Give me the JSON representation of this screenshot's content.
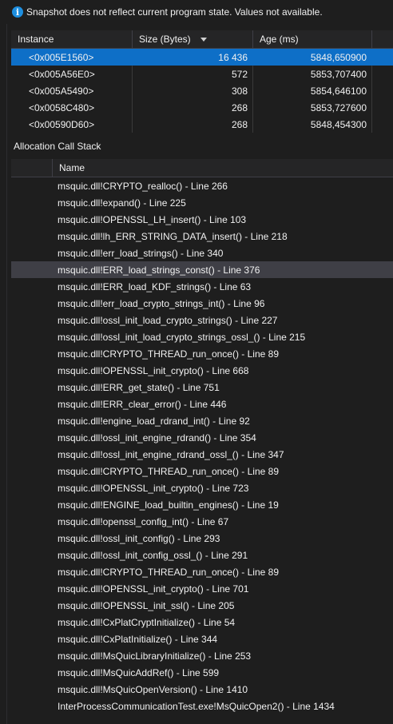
{
  "info_bar": {
    "icon": "info-icon",
    "message": "Snapshot does not reflect current program state. Values not available."
  },
  "instances": {
    "columns": [
      "Instance",
      "Size (Bytes)",
      "Age (ms)"
    ],
    "sort_column": "Size (Bytes)",
    "sort_direction": "descending",
    "rows": [
      {
        "instance": "<0x005E1560>",
        "size": "16 436",
        "age": "5848,650900",
        "selected": true
      },
      {
        "instance": "<0x005A56E0>",
        "size": "572",
        "age": "5853,707400",
        "selected": false
      },
      {
        "instance": "<0x005A5490>",
        "size": "308",
        "age": "5854,646100",
        "selected": false
      },
      {
        "instance": "<0x0058C480>",
        "size": "268",
        "age": "5853,727600",
        "selected": false
      },
      {
        "instance": "<0x00590D60>",
        "size": "268",
        "age": "5848,454300",
        "selected": false
      }
    ]
  },
  "call_stack": {
    "title": "Allocation Call Stack",
    "column": "Name",
    "highlighted_index": 5,
    "frames": [
      "msquic.dll!CRYPTO_realloc() - Line 266",
      "msquic.dll!expand() - Line 225",
      "msquic.dll!OPENSSL_LH_insert() - Line 103",
      "msquic.dll!lh_ERR_STRING_DATA_insert() - Line 218",
      "msquic.dll!err_load_strings() - Line 340",
      "msquic.dll!ERR_load_strings_const() - Line 376",
      "msquic.dll!ERR_load_KDF_strings() - Line 63",
      "msquic.dll!err_load_crypto_strings_int() - Line 96",
      "msquic.dll!ossl_init_load_crypto_strings() - Line 227",
      "msquic.dll!ossl_init_load_crypto_strings_ossl_() - Line 215",
      "msquic.dll!CRYPTO_THREAD_run_once() - Line 89",
      "msquic.dll!OPENSSL_init_crypto() - Line 668",
      "msquic.dll!ERR_get_state() - Line 751",
      "msquic.dll!ERR_clear_error() - Line 446",
      "msquic.dll!engine_load_rdrand_int() - Line 92",
      "msquic.dll!ossl_init_engine_rdrand() - Line 354",
      "msquic.dll!ossl_init_engine_rdrand_ossl_() - Line 347",
      "msquic.dll!CRYPTO_THREAD_run_once() - Line 89",
      "msquic.dll!OPENSSL_init_crypto() - Line 723",
      "msquic.dll!ENGINE_load_builtin_engines() - Line 19",
      "msquic.dll!openssl_config_int() - Line 67",
      "msquic.dll!ossl_init_config() - Line 293",
      "msquic.dll!ossl_init_config_ossl_() - Line 291",
      "msquic.dll!CRYPTO_THREAD_run_once() - Line 89",
      "msquic.dll!OPENSSL_init_crypto() - Line 701",
      "msquic.dll!OPENSSL_init_ssl() - Line 205",
      "msquic.dll!CxPlatCryptInitialize() - Line 54",
      "msquic.dll!CxPlatInitialize() - Line 344",
      "msquic.dll!MsQuicLibraryInitialize() - Line 253",
      "msquic.dll!MsQuicAddRef() - Line 599",
      "msquic.dll!MsQuicOpenVersion() - Line 1410",
      "InterProcessCommunicationTest.exe!MsQuicOpen2() - Line 1434"
    ]
  }
}
